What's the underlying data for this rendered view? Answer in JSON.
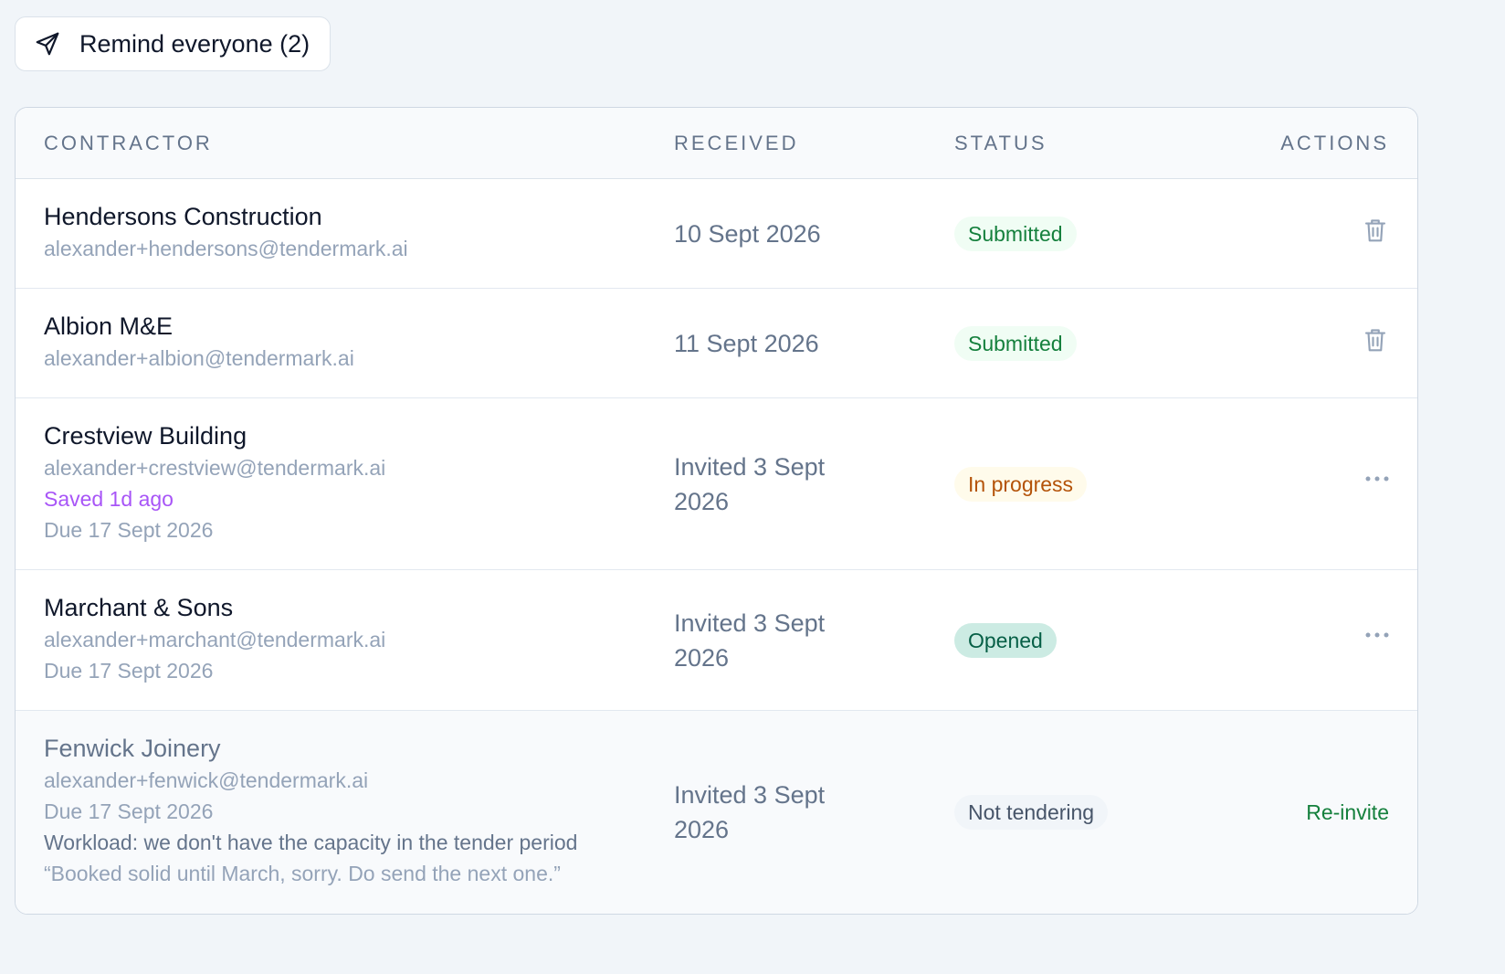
{
  "remind_button": {
    "label": "Remind everyone (2)",
    "icon": "send-icon"
  },
  "table": {
    "headers": {
      "contractor": "CONTRACTOR",
      "received": "RECEIVED",
      "status": "STATUS",
      "actions": "ACTIONS"
    },
    "rows": [
      {
        "name": "Hendersons Construction",
        "email": "alexander+hendersons@tendermark.ai",
        "received": "10 Sept 2026",
        "status": "Submitted",
        "action": "trash-icon"
      },
      {
        "name": "Albion M&E",
        "email": "alexander+albion@tendermark.ai",
        "received": "11 Sept 2026",
        "status": "Submitted",
        "action": "trash-icon"
      },
      {
        "name": "Crestview Building",
        "email": "alexander+crestview@tendermark.ai",
        "saved": "Saved 1d ago",
        "due": "Due 17 Sept 2026",
        "received": "Invited 3 Sept 2026",
        "status": "In progress",
        "action": "more-icon"
      },
      {
        "name": "Marchant & Sons",
        "email": "alexander+marchant@tendermark.ai",
        "due": "Due 17 Sept 2026",
        "received": "Invited 3 Sept 2026",
        "status": "Opened",
        "action": "more-icon"
      },
      {
        "name": "Fenwick Joinery",
        "email": "alexander+fenwick@tendermark.ai",
        "due": "Due 17 Sept 2026",
        "reason": "Workload: we don't have the capacity in the tender period",
        "quote": "“Booked solid until March, sorry. Do send the next one.”",
        "received": "Invited 3 Sept 2026",
        "status": "Not tendering",
        "action_label": "Re-invite"
      }
    ]
  },
  "colors": {
    "background": "#f1f5f9",
    "submitted": "#15803d",
    "in_progress": "#b45309",
    "opened": "#065f46",
    "saved": "#a855f7"
  }
}
